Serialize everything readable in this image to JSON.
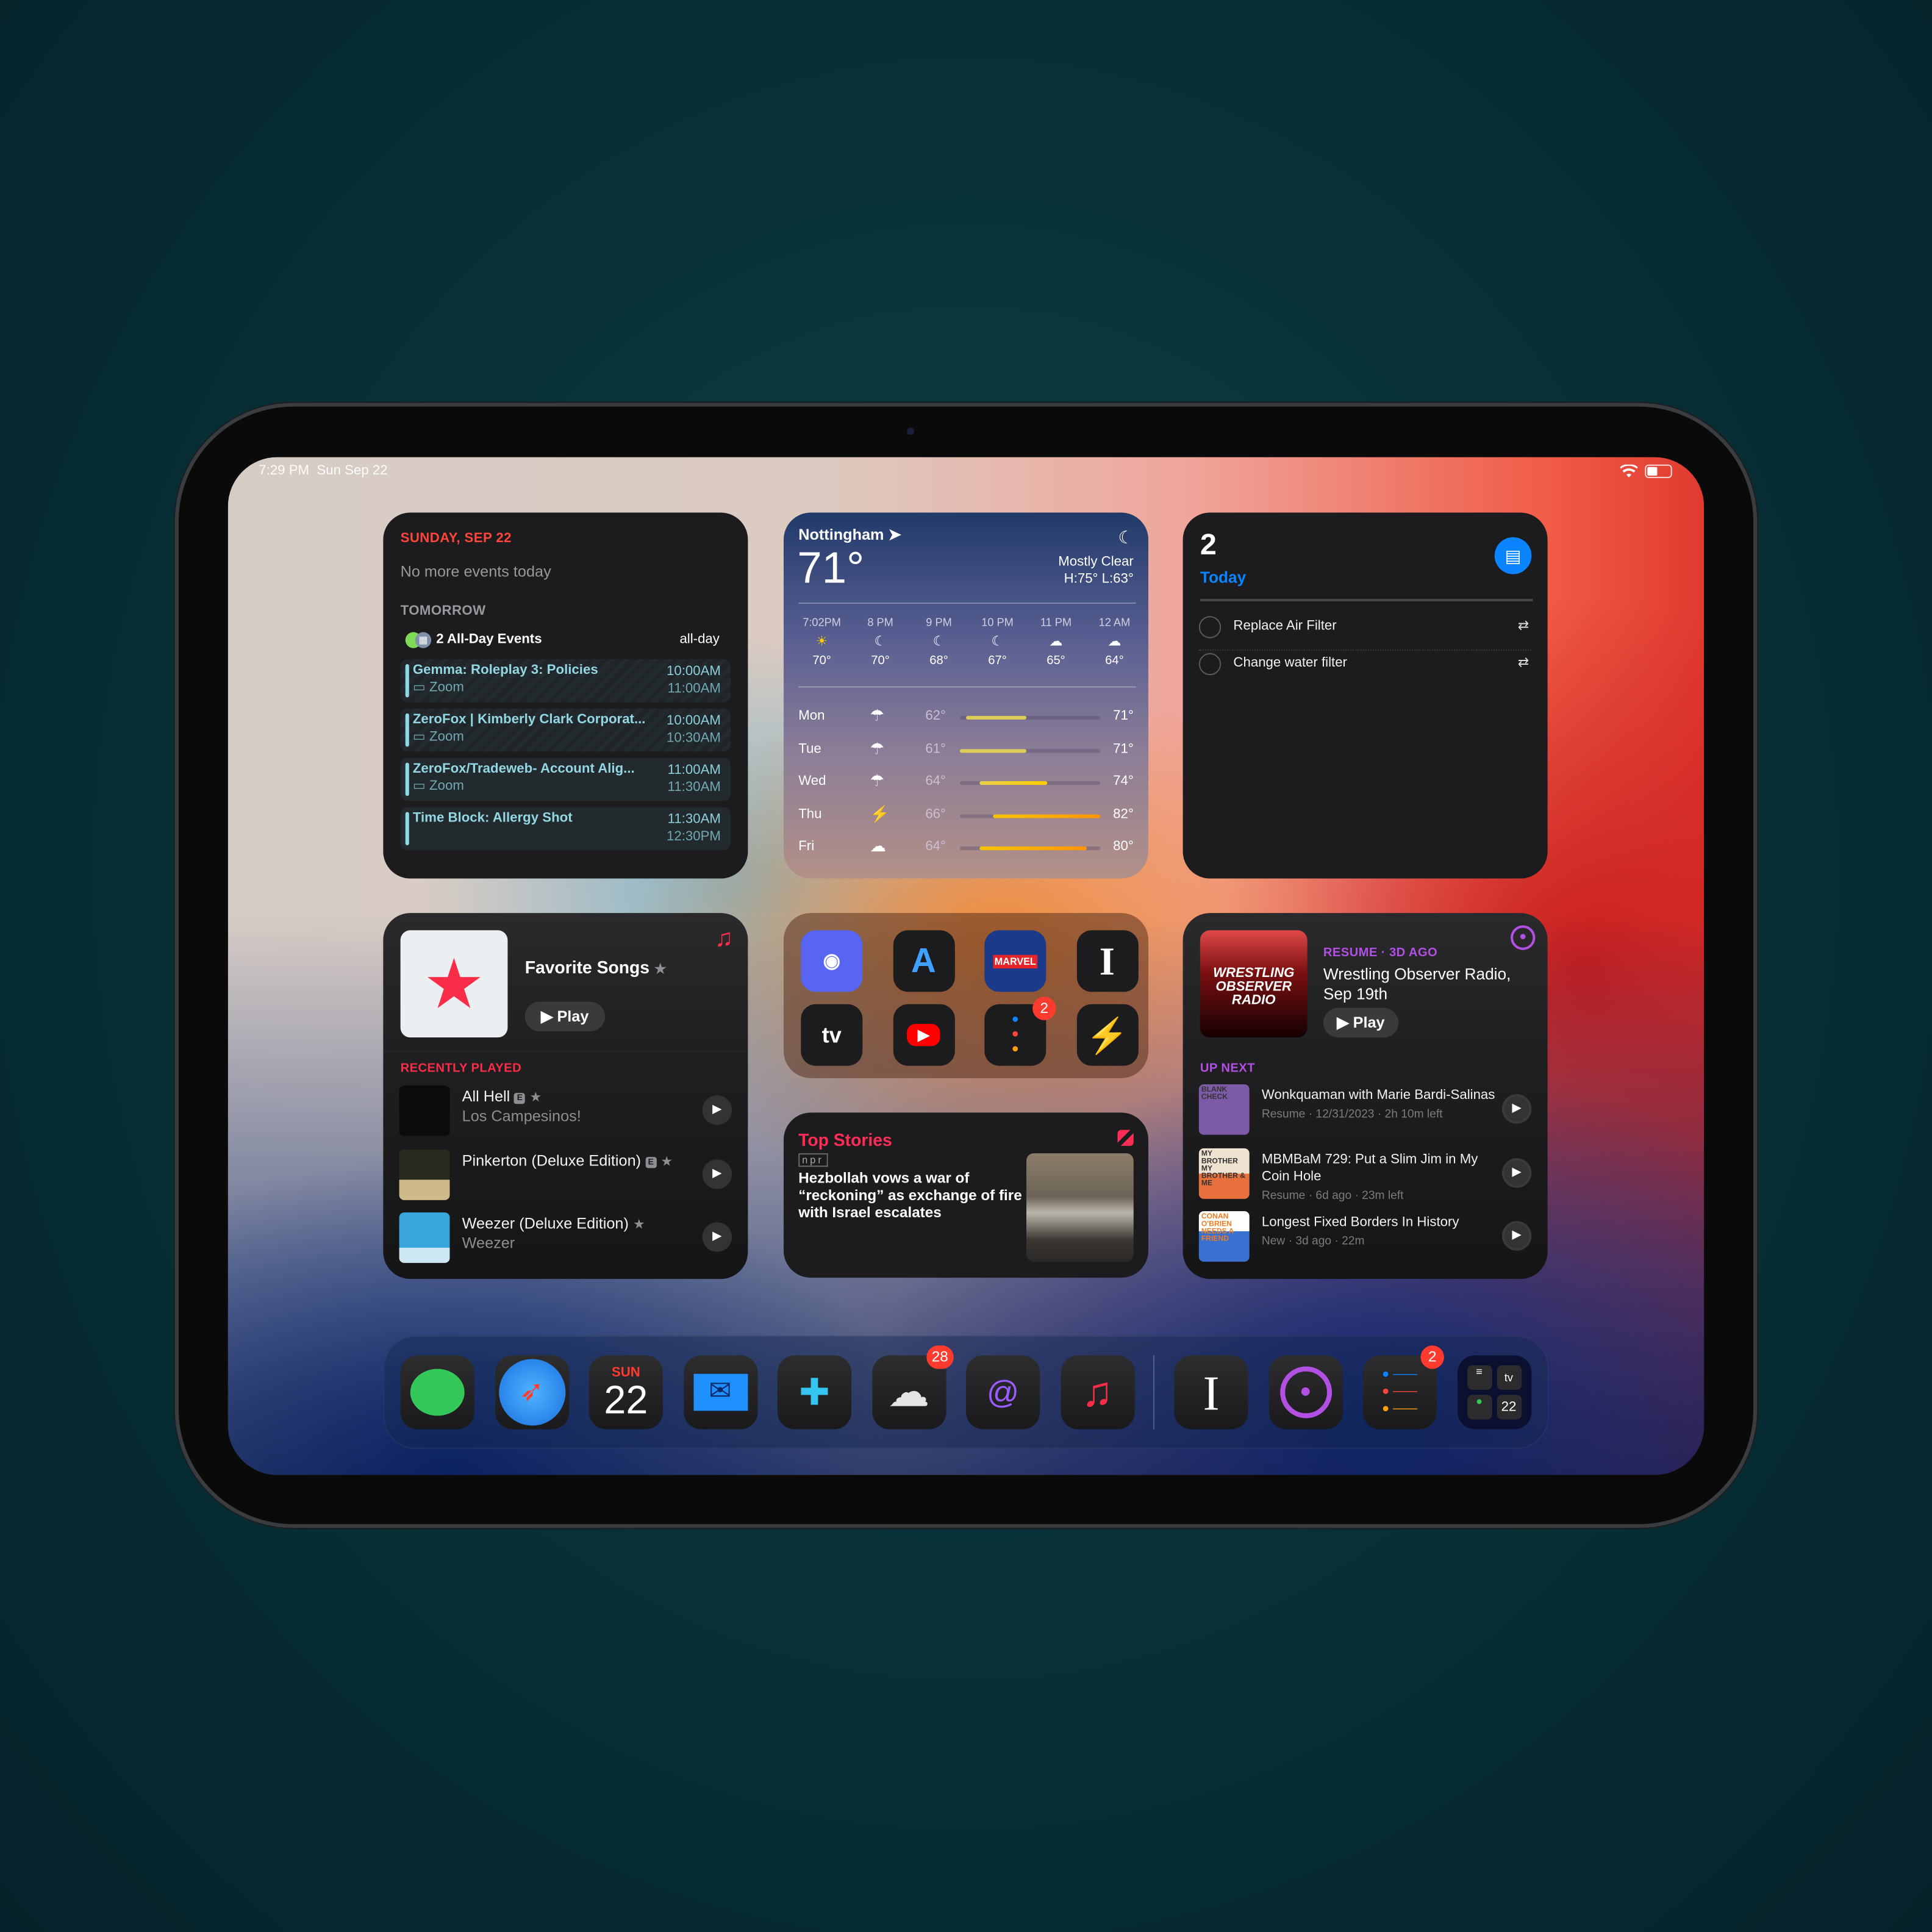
{
  "status_bar": {
    "time": "7:29 PM",
    "date": "Sun Sep 22",
    "wifi_icon": "wifi-icon",
    "battery_level_percent": 45
  },
  "calendar": {
    "date_header": "SUNDAY, SEP 22",
    "today_text": "No more events today",
    "tomorrow_label": "TOMORROW",
    "all_day_label": "2 All-Day Events",
    "all_day_right": "all-day",
    "events": [
      {
        "title": "Gemma: Roleplay 3: Policies",
        "location": "Zoom",
        "start": "10:00AM",
        "end": "11:00AM"
      },
      {
        "title": "ZeroFox | Kimberly Clark Corporat...",
        "location": "Zoom",
        "start": "10:00AM",
        "end": "10:30AM"
      },
      {
        "title": "ZeroFox/Tradeweb- Account Alig...",
        "location": "Zoom",
        "start": "11:00AM",
        "end": "11:30AM"
      },
      {
        "title": "Time Block: Allergy Shot",
        "location": "",
        "start": "11:30AM",
        "end": "12:30PM"
      }
    ],
    "accent": "#ff453a",
    "event_color": "#93d6e4"
  },
  "weather": {
    "city": "Nottingham",
    "temp": "71°",
    "condition": "Mostly Clear",
    "hilo": "H:75° L:63°",
    "hourly": [
      {
        "time": "7:02PM",
        "icon": "sunset-icon",
        "temp": "70°"
      },
      {
        "time": "8 PM",
        "icon": "moon-icon",
        "temp": "70°"
      },
      {
        "time": "9 PM",
        "icon": "moon-icon",
        "temp": "68°"
      },
      {
        "time": "10 PM",
        "icon": "moon-icon",
        "temp": "67°"
      },
      {
        "time": "11 PM",
        "icon": "cloud-moon-icon",
        "temp": "65°"
      },
      {
        "time": "12 AM",
        "icon": "cloud-moon-icon",
        "temp": "64°"
      }
    ],
    "daily": [
      {
        "day": "Mon",
        "icon": "cloud-rain-icon",
        "lo": 62,
        "hi": 71,
        "lo_label": "62°",
        "hi_label": "71°"
      },
      {
        "day": "Tue",
        "icon": "cloud-rain-icon",
        "lo": 61,
        "hi": 71,
        "lo_label": "61°",
        "hi_label": "71°"
      },
      {
        "day": "Wed",
        "icon": "cloud-rain-icon",
        "lo": 64,
        "hi": 74,
        "lo_label": "64°",
        "hi_label": "74°"
      },
      {
        "day": "Thu",
        "icon": "cloud-bolt-rain-icon",
        "lo": 66,
        "hi": 82,
        "lo_label": "66°",
        "hi_label": "82°"
      },
      {
        "day": "Fri",
        "icon": "cloud-icon",
        "lo": 64,
        "hi": 80,
        "lo_label": "64°",
        "hi_label": "80°"
      }
    ],
    "range": [
      61,
      82
    ]
  },
  "reminders": {
    "count": "2",
    "list": "Today",
    "accent": "#0a84ff",
    "items": [
      {
        "title": "Replace Air Filter",
        "repeat": true
      },
      {
        "title": "Change water filter",
        "repeat": true
      }
    ]
  },
  "music": {
    "playlist": "Favorite Songs",
    "play_label": "Play",
    "section": "RECENTLY PLAYED",
    "accent": "#fa2d48",
    "items": [
      {
        "title": "All Hell",
        "explicit": "E",
        "subtitle": "Los Campesinos!"
      },
      {
        "title": "Pinkerton (Deluxe Edition)",
        "explicit": "E",
        "subtitle": ""
      },
      {
        "title": "Weezer (Deluxe Edition)",
        "explicit": "",
        "subtitle": "Weezer"
      }
    ]
  },
  "apps_widget": {
    "apps": [
      {
        "name": "Discord",
        "icon": "discord-icon"
      },
      {
        "name": "App Store",
        "icon": "app-store-icon"
      },
      {
        "name": "Marvel Unlimited",
        "icon": "marvel-icon",
        "label": "MARVEL"
      },
      {
        "name": "Instapaper",
        "icon": "instapaper-icon",
        "label": "I"
      },
      {
        "name": "Apple TV",
        "icon": "apple-tv-icon",
        "label": "tv"
      },
      {
        "name": "YouTube",
        "icon": "youtube-icon"
      },
      {
        "name": "Reminders",
        "icon": "reminders-icon",
        "badge": "2"
      },
      {
        "name": "Reeder",
        "icon": "bolt-icon"
      }
    ]
  },
  "news": {
    "header": "Top Stories",
    "source": "npr",
    "headline": "Hezbollah vows a war of “reckoning” as exchange of fire with Israel escalates",
    "accent": "#ff2d55"
  },
  "podcasts": {
    "status": "RESUME · 3D AGO",
    "episode": "Wrestling Observer Radio, Sep 19th",
    "play_label": "Play",
    "artwork_text": "WRESTLING OBSERVER RADIO",
    "section": "UP NEXT",
    "accent": "#b150e2",
    "items": [
      {
        "title": "Wonkquaman with Marie Bardi-Salinas",
        "meta": "Resume · 12/31/2023 · 2h 10m left",
        "artwork_text": "BLANK CHECK"
      },
      {
        "title": "MBMBaM 729: Put a Slim Jim in My Coin Hole",
        "meta": "Resume · 6d ago · 23m left",
        "artwork_text": "MY BROTHER MY BROTHER & ME"
      },
      {
        "title": "Longest Fixed Borders In History",
        "meta": "New · 3d ago · 22m",
        "artwork_text": "CONAN O'BRIEN NEEDS A FRIEND"
      }
    ]
  },
  "dock": {
    "apps": [
      {
        "name": "Messages",
        "icon": "messages-icon"
      },
      {
        "name": "Safari",
        "icon": "safari-icon"
      },
      {
        "name": "Calendar",
        "icon": "calendar-icon",
        "day": "SUN",
        "date": "22"
      },
      {
        "name": "Mail",
        "icon": "mail-icon"
      },
      {
        "name": "Slack",
        "icon": "slack-icon"
      },
      {
        "name": "Reeder Cloud",
        "icon": "cloud-star-icon",
        "badge": "28"
      },
      {
        "name": "Mastodon client",
        "icon": "mastodon-icon"
      },
      {
        "name": "Music",
        "icon": "music-icon"
      }
    ],
    "recent": [
      {
        "name": "Instapaper",
        "icon": "instapaper-icon",
        "label": "I"
      },
      {
        "name": "Podcasts",
        "icon": "podcasts-icon"
      },
      {
        "name": "Reminders",
        "icon": "reminders-icon",
        "badge": "2"
      },
      {
        "name": "App Library",
        "icon": "app-library-icon",
        "tv": "tv",
        "date": "22"
      }
    ]
  }
}
